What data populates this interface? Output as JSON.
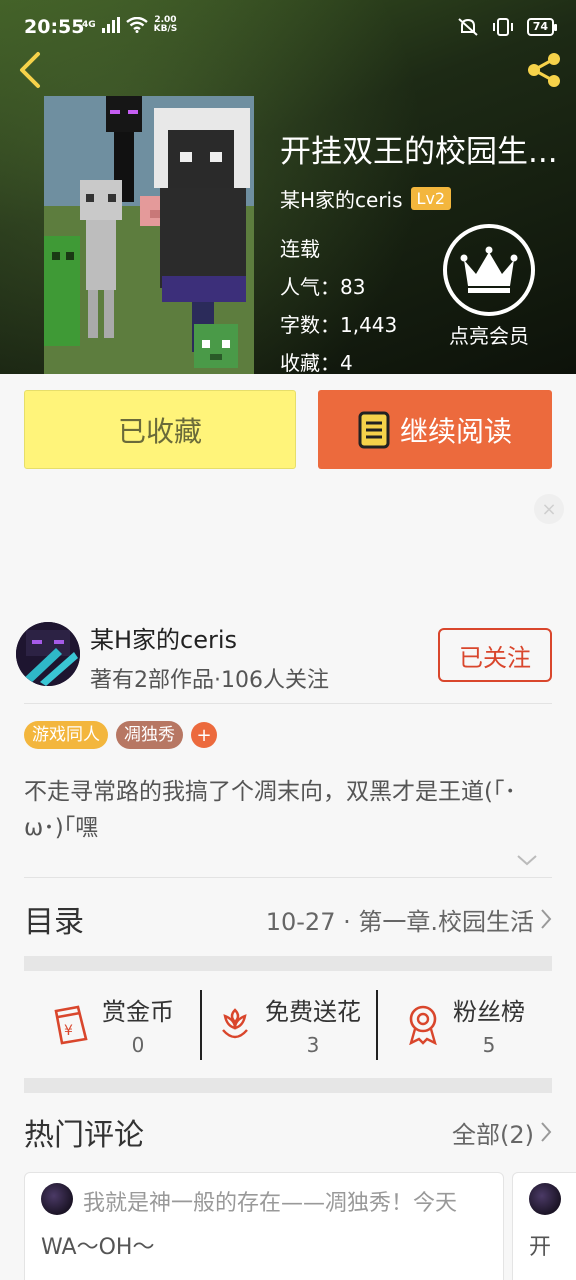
{
  "status_bar": {
    "time": "20:55",
    "network": "4G",
    "speed_value": "2.00",
    "speed_unit": "KB/S",
    "battery": "74"
  },
  "book": {
    "title": "开挂双王的校园生...",
    "author": "某H家的ceris",
    "author_level": "Lv2",
    "status": "连载",
    "popularity": "人气：83",
    "word_count": "字数：1,443",
    "favorites": "收藏：4"
  },
  "vip": {
    "label": "点亮会员"
  },
  "actions": {
    "collected_label": "已收藏",
    "read_label": "继续阅读"
  },
  "ad": {
    "close_icon": "×"
  },
  "author_card": {
    "name": "某H家的ceris",
    "subtitle": "著有2部作品·106人关注",
    "follow_label": "已关注"
  },
  "tags": [
    {
      "label": "游戏同人",
      "color": "#f3b63d"
    },
    {
      "label": "凋独秀",
      "color": "#b77763"
    }
  ],
  "tag_add": "+",
  "description": "不走寻常路的我搞了个凋末向，双黑才是王道(｢･ω･)｢嘿",
  "catalog": {
    "title": "目录",
    "latest": "10-27 · 第一章.校园生活"
  },
  "rewards": [
    {
      "label": "赏金币",
      "count": "0",
      "icon": "red-envelope-icon"
    },
    {
      "label": "免费送花",
      "count": "3",
      "icon": "flower-icon"
    },
    {
      "label": "粉丝榜",
      "count": "5",
      "icon": "medal-icon"
    }
  ],
  "hot_comments": {
    "title": "热门评论",
    "all_label": "全部(2)",
    "items": [
      {
        "line1": "我就是神一般的存在——凋独秀！今天",
        "line2": "WA～OH～"
      },
      {
        "line1": "",
        "line2": "开"
      }
    ]
  },
  "colors": {
    "accent_orange": "#ec6a3d",
    "collected_yellow": "#fff47a",
    "follow_red": "#d9462c",
    "level_gold": "#f3b63d"
  }
}
